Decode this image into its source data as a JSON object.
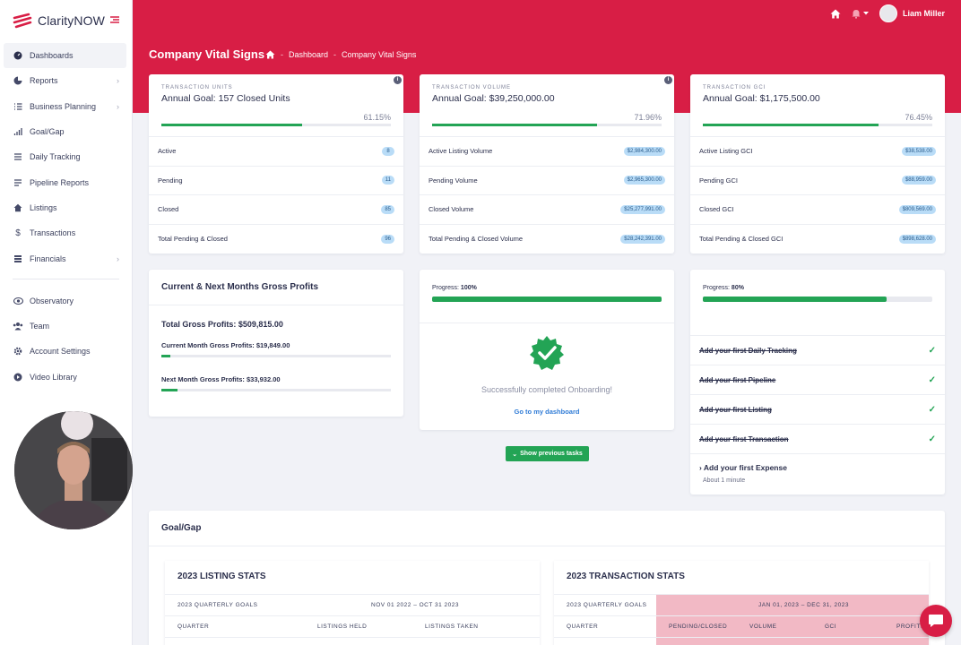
{
  "brand": {
    "name": "ClarityNOW"
  },
  "sidebar": {
    "items": [
      {
        "label": "Dashboards",
        "icon": "dashboard-icon"
      },
      {
        "label": "Reports",
        "icon": "pie-chart-icon"
      },
      {
        "label": "Business Planning",
        "icon": "list-check-icon"
      },
      {
        "label": "Goal/Gap",
        "icon": "bar-chart-icon"
      },
      {
        "label": "Daily Tracking",
        "icon": "list-icon"
      },
      {
        "label": "Pipeline Reports",
        "icon": "lines-icon"
      },
      {
        "label": "Listings",
        "icon": "home-icon"
      },
      {
        "label": "Transactions",
        "icon": "dollar-icon"
      },
      {
        "label": "Financials",
        "icon": "stack-icon"
      },
      {
        "label": "Observatory",
        "icon": "eye-icon"
      },
      {
        "label": "Team",
        "icon": "team-icon"
      },
      {
        "label": "Account Settings",
        "icon": "gear-icon"
      },
      {
        "label": "Video Library",
        "icon": "play-circle-icon"
      }
    ]
  },
  "header": {
    "user_name": "Liam Miller"
  },
  "page": {
    "title": "Company Vital Signs",
    "breadcrumb": [
      "Dashboard",
      "Company Vital Signs"
    ]
  },
  "goal_cards": [
    {
      "kicker": "TRANSACTION UNITS",
      "title": "Annual Goal: 157 Closed Units",
      "percent": "61.15%",
      "progress": 0.6115,
      "rows": [
        {
          "label": "Active",
          "value": "8"
        },
        {
          "label": "Pending",
          "value": "11"
        },
        {
          "label": "Closed",
          "value": "85"
        },
        {
          "label": "Total Pending & Closed",
          "value": "96"
        }
      ]
    },
    {
      "kicker": "TRANSACTION VOLUME",
      "title": "Annual Goal: $39,250,000.00",
      "percent": "71.96%",
      "progress": 0.7196,
      "rows": [
        {
          "label": "Active Listing Volume",
          "value": "$2,984,300.00"
        },
        {
          "label": "Pending Volume",
          "value": "$2,965,300.00"
        },
        {
          "label": "Closed Volume",
          "value": "$25,277,991.00"
        },
        {
          "label": "Total Pending & Closed Volume",
          "value": "$28,242,391.00"
        }
      ]
    },
    {
      "kicker": "TRANSACTION GCI",
      "title": "Annual Goal: $1,175,500.00",
      "percent": "76.45%",
      "progress": 0.7645,
      "rows": [
        {
          "label": "Active Listing GCI",
          "value": "$38,538.00"
        },
        {
          "label": "Pending GCI",
          "value": "$88,959.00"
        },
        {
          "label": "Closed GCI",
          "value": "$809,569.00"
        },
        {
          "label": "Total Pending & Closed GCI",
          "value": "$898,628.00"
        }
      ]
    }
  ],
  "gross_profits": {
    "title": "Current & Next Months Gross Profits",
    "total": "Total Gross Profits: $509,815.00",
    "current": "Current Month Gross Profits: $19,849.00",
    "current_progress": 0.04,
    "next": "Next Month Gross Profits: $33,932.00",
    "next_progress": 0.07
  },
  "onboarding": {
    "progress_label": "Progress:",
    "progress_value": "100%",
    "progress": 1.0,
    "message": "Successfully completed Onboarding!",
    "link": "Go to my dashboard",
    "show_previous": "Show previous tasks"
  },
  "tasks": {
    "progress_label": "Progress:",
    "progress_value": "80%",
    "progress": 0.8,
    "done": [
      "Add your first Daily Tracking",
      "Add your first Pipeline",
      "Add your first Listing",
      "Add your first Transaction"
    ],
    "next_title": "Add your first Expense",
    "next_sub": "About 1 minute"
  },
  "goal_gap": {
    "title": "Goal/Gap",
    "listing": {
      "title": "2023 LISTING STATS",
      "goals_label": "2023 QUARTERLY GOALS",
      "range": "NOV 01 2022 – OCT 31 2023",
      "cols": [
        "QUARTER",
        "LISTINGS HELD",
        "LISTINGS TAKEN"
      ]
    },
    "transaction": {
      "title": "2023 TRANSACTION STATS",
      "goals_label": "2023 QUARTERLY GOALS",
      "range": "JAN 01, 2023 – DEC 31, 2023",
      "cols": [
        "QUARTER",
        "PENDING/CLOSED",
        "VOLUME",
        "GCI",
        "PROFITS"
      ]
    }
  },
  "colors": {
    "brand": "#d81e45",
    "success": "#23a455",
    "pill": "#b9dcf7"
  }
}
